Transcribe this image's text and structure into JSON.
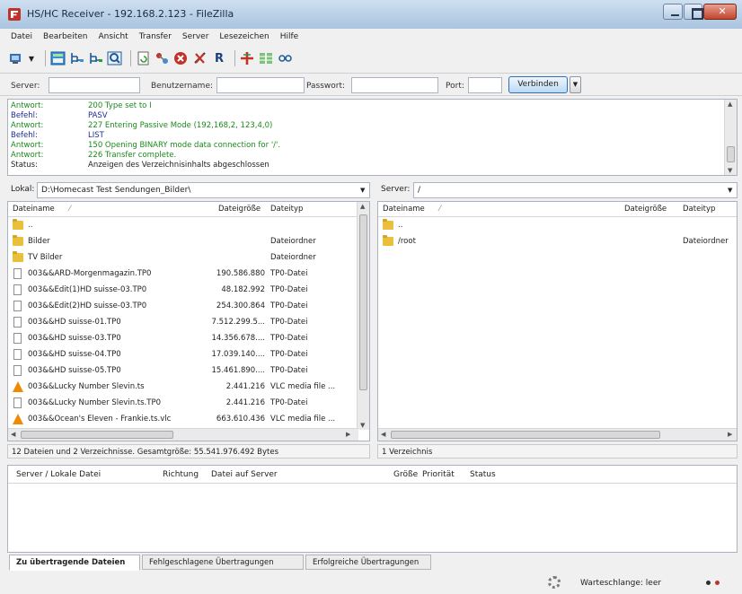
{
  "window": {
    "title": "HS/HC Receiver - 192.168.2.123 - FileZilla"
  },
  "menu": [
    "Datei",
    "Bearbeiten",
    "Ansicht",
    "Transfer",
    "Server",
    "Lesezeichen",
    "Hilfe"
  ],
  "toolbar": {
    "icons": [
      "site-manager-icon",
      "toggle-log-icon",
      "toggle-local-tree-icon",
      "toggle-remote-tree-icon",
      "toggle-queue-icon",
      "refresh-icon",
      "process-queue-icon",
      "cancel-icon",
      "disconnect-icon",
      "reconnect-icon",
      "filter-icon",
      "compare-icon",
      "sync-browse-icon"
    ],
    "reconnect_glyph": "R"
  },
  "quickconnect": {
    "server_label": "Server:",
    "user_label": "Benutzername:",
    "pass_label": "Passwort:",
    "port_label": "Port:",
    "server_value": "",
    "user_value": "",
    "pass_value": "",
    "port_value": "",
    "connect_label": "Verbinden"
  },
  "log": [
    {
      "k": "Antwort:",
      "v": "200 Type set to I",
      "color": "#1a8a1a"
    },
    {
      "k": "Befehl:",
      "v": "PASV",
      "color": "#1d2b9a"
    },
    {
      "k": "Antwort:",
      "v": "227 Entering Passive Mode (192,168,2, 123,4,0)",
      "color": "#1a8a1a"
    },
    {
      "k": "Befehl:",
      "v": "LIST",
      "color": "#1d2b9a"
    },
    {
      "k": "Antwort:",
      "v": "150 Opening BINARY mode data connection for '/'.",
      "color": "#1a8a1a"
    },
    {
      "k": "Antwort:",
      "v": "226 Transfer complete.",
      "color": "#1a8a1a"
    },
    {
      "k": "Status:",
      "v": "Anzeigen des Verzeichnisinhalts abgeschlossen",
      "color": "#222222"
    }
  ],
  "local": {
    "path_label": "Lokal:",
    "path": "D:\\Homecast Test Sendungen_Bilder\\",
    "col_name": "Dateiname",
    "col_size": "Dateigröße",
    "col_type": "Dateityp",
    "files": [
      {
        "icon": "folder",
        "name": "..",
        "size": "",
        "type": ""
      },
      {
        "icon": "folder",
        "name": "Bilder",
        "size": "",
        "type": "Dateiordner"
      },
      {
        "icon": "folder",
        "name": "TV Bilder",
        "size": "",
        "type": "Dateiordner"
      },
      {
        "icon": "file",
        "name": "003&&ARD-Morgenmagazin.TP0",
        "size": "190.586.880",
        "type": "TP0-Datei"
      },
      {
        "icon": "file",
        "name": "003&&Edit(1)HD suisse-03.TP0",
        "size": "48.182.992",
        "type": "TP0-Datei"
      },
      {
        "icon": "file",
        "name": "003&&Edit(2)HD suisse-03.TP0",
        "size": "254.300.864",
        "type": "TP0-Datei"
      },
      {
        "icon": "file",
        "name": "003&&HD suisse-01.TP0",
        "size": "7.512.299.5...",
        "type": "TP0-Datei"
      },
      {
        "icon": "file",
        "name": "003&&HD suisse-03.TP0",
        "size": "14.356.678....",
        "type": "TP0-Datei"
      },
      {
        "icon": "file",
        "name": "003&&HD suisse-04.TP0",
        "size": "17.039.140....",
        "type": "TP0-Datei"
      },
      {
        "icon": "file",
        "name": "003&&HD suisse-05.TP0",
        "size": "15.461.890....",
        "type": "TP0-Datei"
      },
      {
        "icon": "vlc",
        "name": "003&&Lucky Number Slevin.ts",
        "size": "2.441.216",
        "type": "VLC media file ..."
      },
      {
        "icon": "file",
        "name": "003&&Lucky Number Slevin.ts.TP0",
        "size": "2.441.216",
        "type": "TP0-Datei"
      },
      {
        "icon": "vlc",
        "name": "003&&Ocean's Eleven - Frankie.ts.vlc",
        "size": "663.610.436",
        "type": "VLC media file ..."
      }
    ],
    "status": "12 Dateien und 2 Verzeichnisse. Gesamtgröße: 55.541.976.492 Bytes"
  },
  "remote": {
    "path_label": "Server:",
    "path": "/",
    "col_name": "Dateiname",
    "col_size": "Dateigröße",
    "col_type": "Dateityp",
    "files": [
      {
        "icon": "folder",
        "name": "..",
        "size": "",
        "type": ""
      },
      {
        "icon": "folder",
        "name": "/root",
        "size": "",
        "type": "Dateiordner"
      }
    ],
    "status": "1 Verzeichnis"
  },
  "queue": {
    "col_server": "Server / Lokale Datei",
    "col_direction": "Richtung",
    "col_remote": "Datei auf Server",
    "col_size": "Größe",
    "col_priority": "Priorität",
    "col_status": "Status"
  },
  "tabs": [
    "Zu übertragende Dateien",
    "Fehlgeschlagene Übertragungen",
    "Erfolgreiche Übertragungen"
  ],
  "statusbar": {
    "queue": "Warteschlange: leer"
  },
  "colors": {
    "accent": "#2f6fb5",
    "log_response": "#1a8a1a",
    "log_command": "#1d2b9a",
    "indicator_1": "#2d2d2d",
    "indicator_2": "#c0332b"
  }
}
